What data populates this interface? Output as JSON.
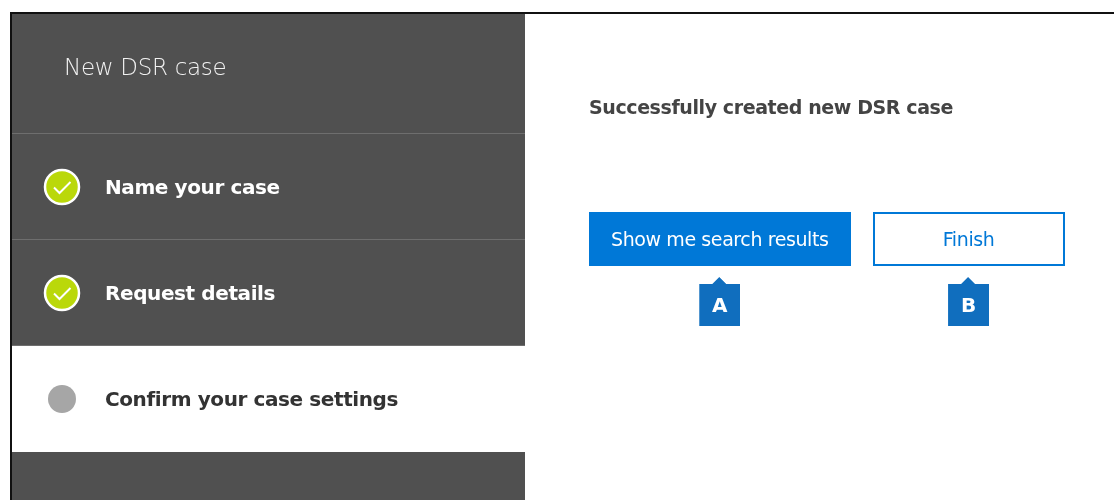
{
  "wizard": {
    "title": "New DSR case",
    "steps": [
      {
        "label": "Name your case",
        "done": true,
        "selected": false
      },
      {
        "label": "Request details",
        "done": true,
        "selected": false
      },
      {
        "label": "Confirm your case settings",
        "done": false,
        "selected": true
      }
    ]
  },
  "content": {
    "message": "Successfully created new DSR case",
    "buttons": [
      {
        "label": "Show me search results",
        "kind": "primary",
        "callout": "A"
      },
      {
        "label": "Finish",
        "kind": "secondary",
        "callout": "B"
      }
    ]
  }
}
